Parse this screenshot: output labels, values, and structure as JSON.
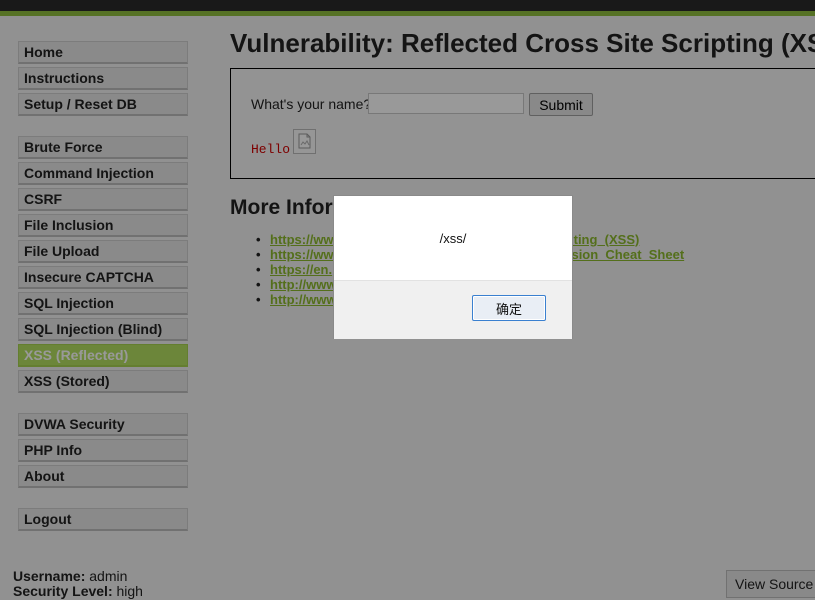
{
  "menu": {
    "group1": [
      "Home",
      "Instructions",
      "Setup / Reset DB"
    ],
    "group2": [
      "Brute Force",
      "Command Injection",
      "CSRF",
      "File Inclusion",
      "File Upload",
      "Insecure CAPTCHA",
      "SQL Injection",
      "SQL Injection (Blind)",
      "XSS (Reflected)",
      "XSS (Stored)"
    ],
    "group3": [
      "DVWA Security",
      "PHP Info",
      "About"
    ],
    "group4": [
      "Logout"
    ],
    "active": "XSS (Reflected)"
  },
  "page": {
    "title": "Vulnerability: Reflected Cross Site Scripting (XS",
    "question_label": "What's your name?",
    "name_value": "",
    "submit_label": "Submit",
    "hello_text": "Hello",
    "more_info_title": "More Infor"
  },
  "links": [
    {
      "start": "https://ww",
      "end": "ripting_(XSS)"
    },
    {
      "start": "https://ww",
      "end": "vasion_Cheat_Sheet"
    },
    {
      "start": "https://en.",
      "end": ""
    },
    {
      "start": "http://www",
      "end": ""
    },
    {
      "start": "http://www",
      "end": ""
    }
  ],
  "footer": {
    "username_label": "Username:",
    "username": "admin",
    "security_label": "Security Level:",
    "security": "high",
    "view_source_label": "View Source"
  },
  "dialog": {
    "message": "/xss/",
    "ok_label": "确定"
  },
  "colors": {
    "accent": "#8fbf3f",
    "active_menu": "#b5e061",
    "link": "#8cba2e",
    "hello": "#d00000"
  }
}
